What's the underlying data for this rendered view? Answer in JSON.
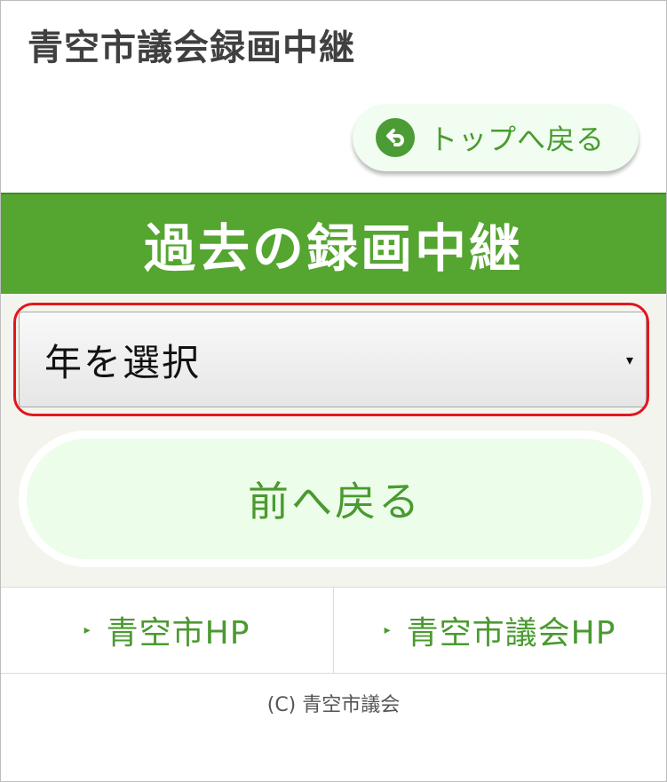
{
  "header": {
    "site_title": "青空市議会録画中継"
  },
  "top_button": {
    "label": "トップへ戻る",
    "icon": "back-arrow-icon"
  },
  "section": {
    "title": "過去の録画中継"
  },
  "year_select": {
    "selected": "年を選択",
    "arrow": "▾"
  },
  "back_button": {
    "label": "前へ戻る"
  },
  "footer_links": [
    {
      "marker": "▸",
      "label": "青空市HP"
    },
    {
      "marker": "▸",
      "label": "青空市議会HP"
    }
  ],
  "copyright": "(C) 青空市議会",
  "colors": {
    "brand_green": "#55a531",
    "text_green": "#4a9a30",
    "highlight_red": "#e4161d"
  }
}
